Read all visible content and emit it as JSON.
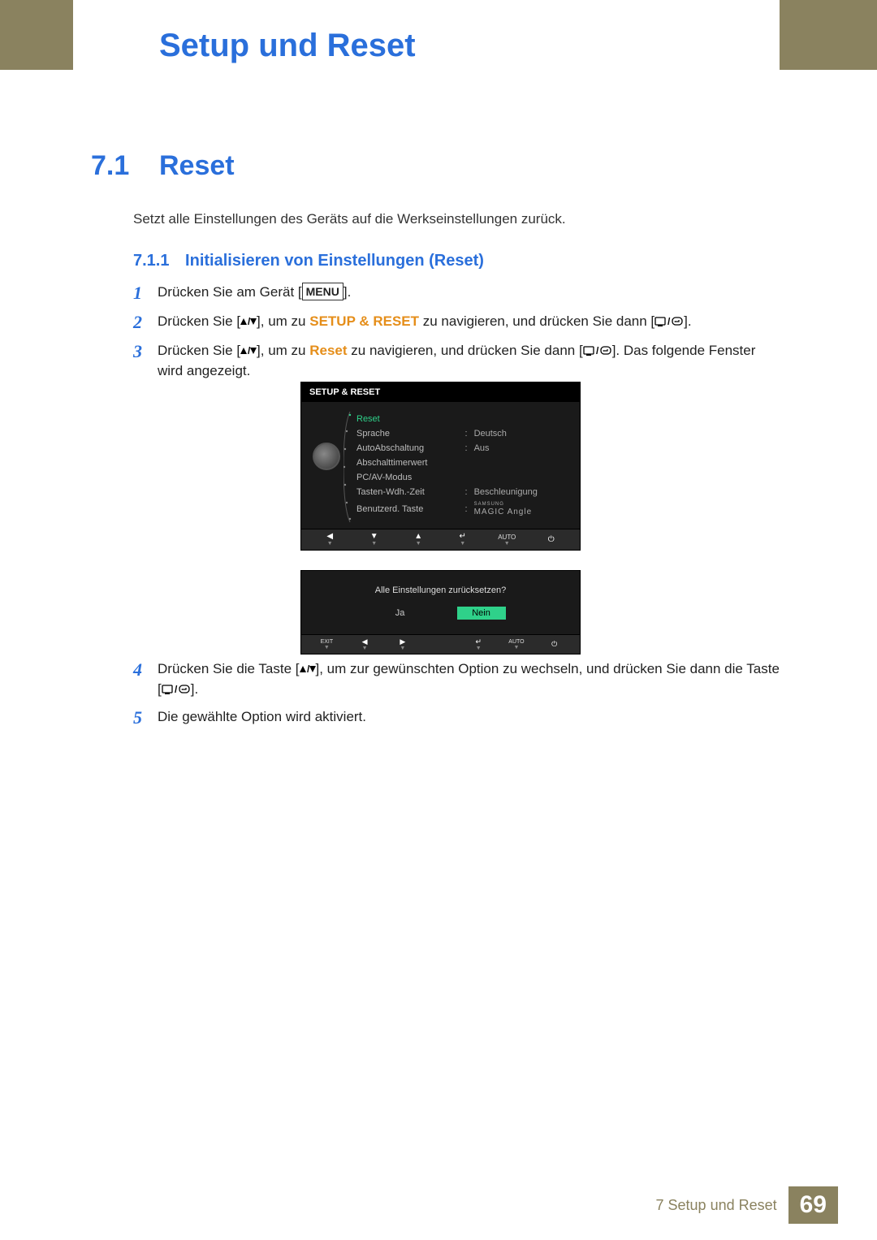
{
  "chapter_title": "Setup und Reset",
  "section": {
    "num": "7.1",
    "title": "Reset"
  },
  "intro": "Setzt alle Einstellungen des Geräts auf die Werkseinstellungen zurück.",
  "subsection": {
    "num": "7.1.1",
    "title": "Initialisieren von Einstellungen (Reset)"
  },
  "menu_label": "MENU",
  "setup_reset_kw": "SETUP & RESET",
  "reset_kw": "Reset",
  "steps": {
    "s1": {
      "num": "1",
      "a": "Drücken Sie am Gerät [",
      "b": "]."
    },
    "s2": {
      "num": "2",
      "a": "Drücken Sie [",
      "b": "], um zu ",
      "c": " zu navigieren, und drücken Sie dann [",
      "d": "]."
    },
    "s3": {
      "num": "3",
      "a": "Drücken Sie [",
      "b": "], um zu ",
      "c": " zu navigieren, und drücken Sie dann [",
      "d": "]. Das folgende Fenster wird angezeigt."
    },
    "s4": {
      "num": "4",
      "a": "Drücken Sie die Taste [",
      "b": "], um zur gewünschten Option zu wechseln, und drücken Sie dann die Taste [",
      "c": "]."
    },
    "s5": {
      "num": "5",
      "a": "Die gewählte Option wird aktiviert."
    }
  },
  "osd1": {
    "title": "SETUP & RESET",
    "rows": [
      {
        "k": "Reset",
        "v": "",
        "sel": true
      },
      {
        "k": "Sprache",
        "v": "Deutsch"
      },
      {
        "k": "AutoAbschaltung",
        "v": "Aus"
      },
      {
        "k": "Abschalttimerwert",
        "v": ""
      },
      {
        "k": "PC/AV-Modus",
        "v": ""
      },
      {
        "k": "Tasten-Wdh.-Zeit",
        "v": "Beschleunigung"
      },
      {
        "k": "Benutzerd. Taste",
        "v": "MAGIC Angle",
        "magic": true,
        "sup": "SAMSUNG"
      }
    ],
    "bar": [
      "◀",
      "▼",
      "▲",
      "↵",
      "AUTO",
      "⏻"
    ]
  },
  "osd2": {
    "msg": "Alle Einstellungen zurücksetzen?",
    "yes": "Ja",
    "no": "Nein",
    "bar": [
      "EXIT",
      "◀",
      "▶",
      "↵",
      "AUTO",
      "⏻"
    ]
  },
  "footer": {
    "text": "7 Setup und Reset",
    "page": "69"
  }
}
